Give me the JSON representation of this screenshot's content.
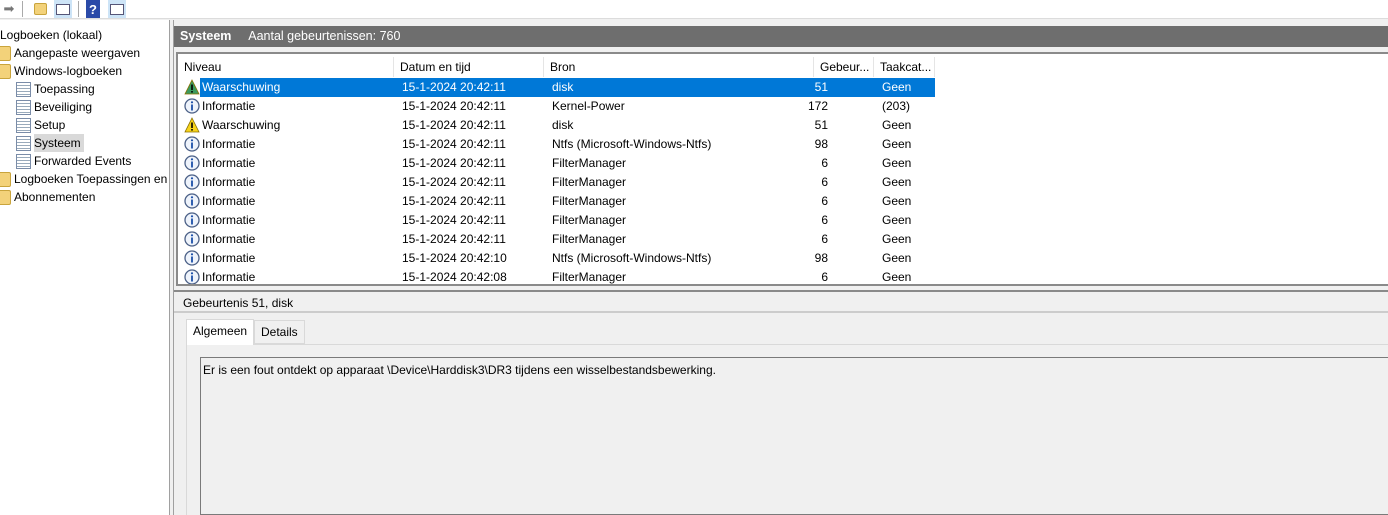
{
  "toolbar": {
    "icons": [
      "forward-arrow-icon",
      "folder-up-icon",
      "show-hide-tree-icon",
      "help-icon",
      "show-hide-actions-icon"
    ]
  },
  "tree": {
    "items": [
      {
        "label": "Logboeken (lokaal)",
        "icon": "none"
      },
      {
        "label": "Aangepaste weergaven",
        "icon": "filter-folder"
      },
      {
        "label": "Windows-logboeken",
        "icon": "windows-folder"
      },
      {
        "label": "Toepassing",
        "icon": "log"
      },
      {
        "label": "Beveiliging",
        "icon": "log"
      },
      {
        "label": "Setup",
        "icon": "log"
      },
      {
        "label": "Systeem",
        "icon": "log",
        "selected": true
      },
      {
        "label": "Forwarded Events",
        "icon": "log"
      },
      {
        "label": "Logboeken Toepassingen en",
        "icon": "folder"
      },
      {
        "label": "Abonnementen",
        "icon": "subscription"
      }
    ]
  },
  "header": {
    "title": "Systeem",
    "count_label": "Aantal gebeurtenissen: 760"
  },
  "table": {
    "columns": [
      "Niveau",
      "Datum en tijd",
      "Bron",
      "Gebeur...",
      "Taakcat..."
    ],
    "rows": [
      {
        "level": "Waarschuwing",
        "date": "15-1-2024 20:42:11",
        "source": "disk",
        "id": "51",
        "task": "Geen",
        "selected": true
      },
      {
        "level": "Informatie",
        "date": "15-1-2024 20:42:11",
        "source": "Kernel-Power",
        "id": "172",
        "task": "(203)"
      },
      {
        "level": "Waarschuwing",
        "date": "15-1-2024 20:42:11",
        "source": "disk",
        "id": "51",
        "task": "Geen"
      },
      {
        "level": "Informatie",
        "date": "15-1-2024 20:42:11",
        "source": "Ntfs (Microsoft-Windows-Ntfs)",
        "id": "98",
        "task": "Geen"
      },
      {
        "level": "Informatie",
        "date": "15-1-2024 20:42:11",
        "source": "FilterManager",
        "id": "6",
        "task": "Geen"
      },
      {
        "level": "Informatie",
        "date": "15-1-2024 20:42:11",
        "source": "FilterManager",
        "id": "6",
        "task": "Geen"
      },
      {
        "level": "Informatie",
        "date": "15-1-2024 20:42:11",
        "source": "FilterManager",
        "id": "6",
        "task": "Geen"
      },
      {
        "level": "Informatie",
        "date": "15-1-2024 20:42:11",
        "source": "FilterManager",
        "id": "6",
        "task": "Geen"
      },
      {
        "level": "Informatie",
        "date": "15-1-2024 20:42:11",
        "source": "FilterManager",
        "id": "6",
        "task": "Geen"
      },
      {
        "level": "Informatie",
        "date": "15-1-2024 20:42:10",
        "source": "Ntfs (Microsoft-Windows-Ntfs)",
        "id": "98",
        "task": "Geen"
      },
      {
        "level": "Informatie",
        "date": "15-1-2024 20:42:08",
        "source": "FilterManager",
        "id": "6",
        "task": "Geen"
      }
    ]
  },
  "detail": {
    "title": "Gebeurtenis 51, disk",
    "tabs": [
      "Algemeen",
      "Details"
    ],
    "message": "Er is een fout ontdekt op apparaat \\Device\\Harddisk3\\DR3 tijdens een wisselbestandsbewerking."
  },
  "colors": {
    "selection": "#0078d7",
    "header_bar": "#6e6e6e"
  }
}
